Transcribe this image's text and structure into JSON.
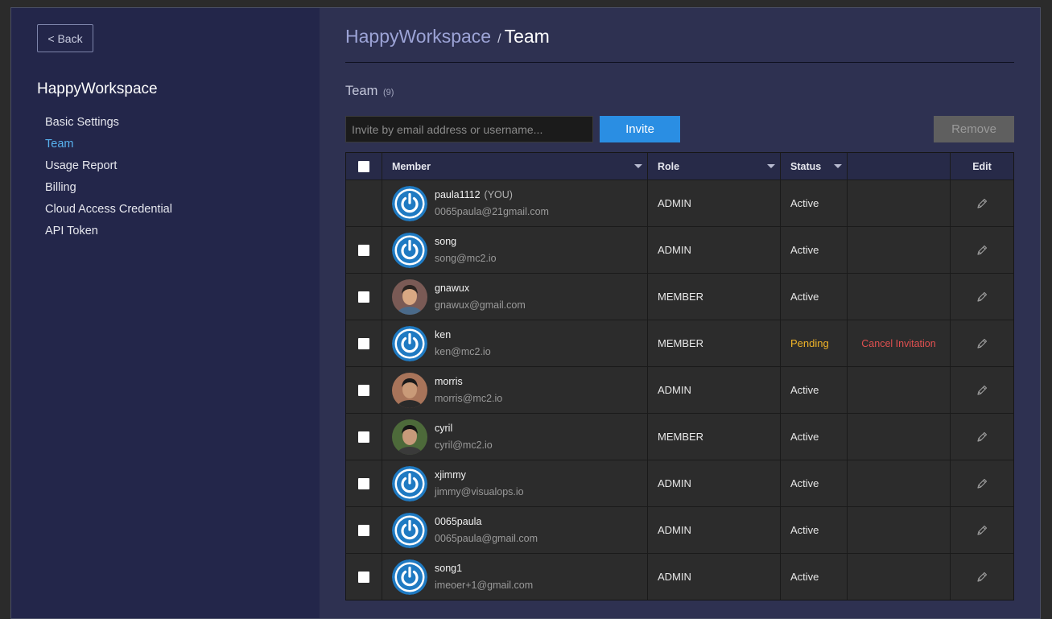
{
  "sidebar": {
    "back_label": "< Back",
    "workspace_title": "HappyWorkspace",
    "nav": [
      {
        "label": "Basic Settings",
        "active": false
      },
      {
        "label": "Team",
        "active": true
      },
      {
        "label": "Usage Report",
        "active": false
      },
      {
        "label": "Billing",
        "active": false
      },
      {
        "label": "Cloud Access Credential",
        "active": false
      },
      {
        "label": "API Token",
        "active": false
      }
    ]
  },
  "header": {
    "workspace": "HappyWorkspace",
    "separator": "/",
    "page": "Team"
  },
  "section": {
    "title": "Team",
    "count": "(9)"
  },
  "invite": {
    "placeholder": "Invite by email address or username...",
    "value": "",
    "button_label": "Invite",
    "remove_label": "Remove"
  },
  "table": {
    "headers": {
      "member": "Member",
      "role": "Role",
      "status": "Status",
      "edit": "Edit"
    },
    "rows": [
      {
        "name": "paula1112",
        "you_tag": "(YOU)",
        "email": "0065paula@21gmail.com",
        "role": "ADMIN",
        "status": "Active",
        "action": "",
        "avatar": "power-logo",
        "checkbox": false
      },
      {
        "name": "song",
        "you_tag": "",
        "email": "song@mc2.io",
        "role": "ADMIN",
        "status": "Active",
        "action": "",
        "avatar": "power-logo",
        "checkbox": true
      },
      {
        "name": "gnawux",
        "you_tag": "",
        "email": "gnawux@gmail.com",
        "role": "MEMBER",
        "status": "Active",
        "action": "",
        "avatar": "photo-gnawux",
        "checkbox": true
      },
      {
        "name": "ken",
        "you_tag": "",
        "email": "ken@mc2.io",
        "role": "MEMBER",
        "status": "Pending",
        "action": "Cancel Invitation",
        "avatar": "power-logo",
        "checkbox": true
      },
      {
        "name": "morris",
        "you_tag": "",
        "email": "morris@mc2.io",
        "role": "ADMIN",
        "status": "Active",
        "action": "",
        "avatar": "photo-morris",
        "checkbox": true
      },
      {
        "name": "cyril",
        "you_tag": "",
        "email": "cyril@mc2.io",
        "role": "MEMBER",
        "status": "Active",
        "action": "",
        "avatar": "photo-cyril",
        "checkbox": true
      },
      {
        "name": "xjimmy",
        "you_tag": "",
        "email": "jimmy@visualops.io",
        "role": "ADMIN",
        "status": "Active",
        "action": "",
        "avatar": "power-logo",
        "checkbox": true
      },
      {
        "name": "0065paula",
        "you_tag": "",
        "email": "0065paula@gmail.com",
        "role": "ADMIN",
        "status": "Active",
        "action": "",
        "avatar": "power-logo",
        "checkbox": true
      },
      {
        "name": "song1",
        "you_tag": "",
        "email": "imeoer+1@gmail.com",
        "role": "ADMIN",
        "status": "Active",
        "action": "",
        "avatar": "power-logo",
        "checkbox": true
      }
    ]
  },
  "colors": {
    "sidebar_bg": "#23264a",
    "main_bg": "#2e3151",
    "accent": "#2a8ee3",
    "active_nav": "#58b2ef",
    "pending": "#f0b428",
    "danger": "#e05050"
  }
}
